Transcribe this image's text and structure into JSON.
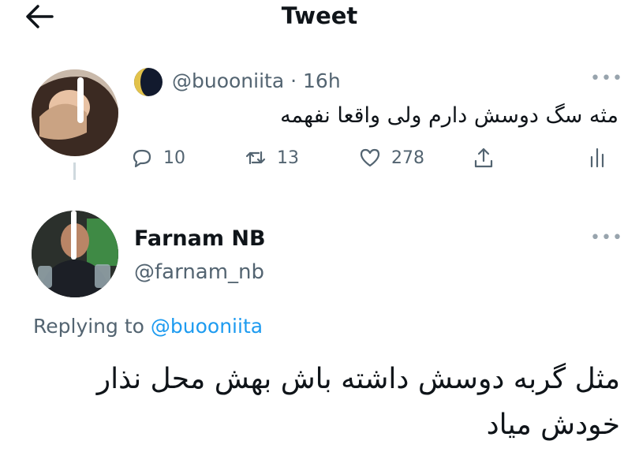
{
  "header": {
    "title": "Tweet",
    "back_icon": "arrow-left-icon"
  },
  "parent_tweet": {
    "handle": "@buooniita",
    "time": "· 16h",
    "text": "مثه سگ دوسش دارم ولی واقعا نفهمه",
    "actions": {
      "reply_count": "10",
      "retweet_count": "13",
      "like_count": "278"
    }
  },
  "reply_tweet": {
    "display_name": "Farnam NB",
    "handle": "@farnam_nb",
    "replying_prefix": "Replying to",
    "replying_to": "@buooniita",
    "text": "مثل گربه دوسش داشته باش بهش محل نذار خودش میاد"
  },
  "colors": {
    "accent": "#1d9bf0",
    "secondary_text": "#536471",
    "thread_line": "#cfd9de"
  }
}
